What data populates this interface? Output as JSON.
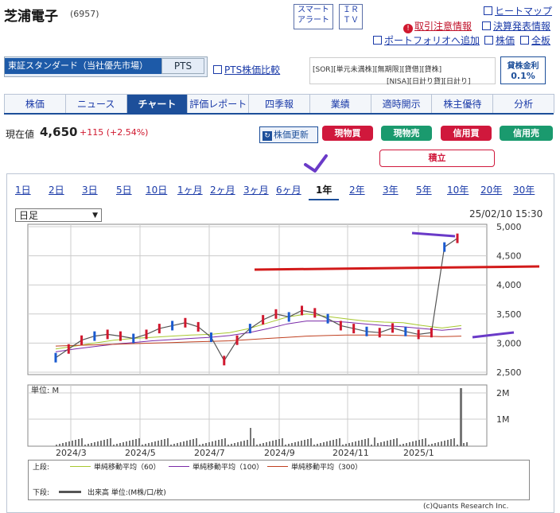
{
  "header": {
    "company_name": "芝浦電子",
    "code": "(6957)",
    "smart_alert_line1": "スマート",
    "smart_alert_line2": "アラート",
    "ir_line1": "ＩＲ",
    "ir_line2": "ＴＶ",
    "links": {
      "heatmap": "ヒートマップ",
      "attention": "取引注意情報",
      "earnings": "決算発表情報",
      "portfolio": "ポートフォリオへ追加",
      "stock_price": "株価",
      "all_boards": "全板"
    }
  },
  "market": {
    "name": "東証スタンダード（当社優先市場）",
    "pts_tab": "PTS",
    "pts_compare": "PTS株価比較",
    "badges_row1": [
      "[SOR]",
      "[単元未満株]",
      "[無期限]",
      "[貸借]",
      "[貸株]"
    ],
    "badges_row2": [
      "[NISA]",
      "[日計り貸]",
      "[日計り]"
    ],
    "lending_label": "貸株金利",
    "lending_rate": "0.1%"
  },
  "nav_tabs": [
    "株価",
    "ニュース",
    "チャート",
    "評価レポート",
    "四季報",
    "業績",
    "適時開示",
    "株主優待",
    "分析"
  ],
  "active_tab": "チャート",
  "price": {
    "label": "現在値",
    "value": "4,650",
    "change": "+115 (+2.54%)",
    "refresh_label": "株価更新"
  },
  "trade_buttons": {
    "cash_buy": "現物買",
    "cash_sell": "現物売",
    "margin_buy": "信用買",
    "margin_sell": "信用売",
    "accumulate": "積立"
  },
  "period_tabs": [
    "1日",
    "2日",
    "3日",
    "5日",
    "10日",
    "1ヶ月",
    "2ヶ月",
    "3ヶ月",
    "6ヶ月",
    "1年",
    "2年",
    "3年",
    "5年",
    "10年",
    "20年",
    "30年"
  ],
  "active_period": "1年",
  "chart_controls": {
    "interval_select": "日足",
    "timestamp": "25/02/10 15:30"
  },
  "chart_data": {
    "type": "line",
    "price_axis": {
      "ylim": [
        2500,
        5000
      ],
      "ticks": [
        "2,500",
        "3,000",
        "3,500",
        "4,000",
        "4,500",
        "5,000"
      ]
    },
    "volume_axis": {
      "label": "単位: M",
      "ticks": [
        "1M",
        "2M"
      ]
    },
    "x_ticks": [
      "2024/3",
      "2024/5",
      "2024/7",
      "2024/9",
      "2024/11",
      "2025/1"
    ],
    "series": [
      {
        "name": "単純移動平均（60）",
        "color": "#a8c830",
        "values": [
          2900,
          2950,
          3000,
          3050,
          3080,
          3100,
          3120,
          3140,
          3150,
          3180,
          3250,
          3350,
          3450,
          3500,
          3460,
          3420,
          3380,
          3360,
          3350,
          3300,
          3260,
          3300
        ]
      },
      {
        "name": "単純移動平均（100）",
        "color": "#7a2aa8",
        "values": [
          2850,
          2900,
          2940,
          2980,
          3010,
          3040,
          3060,
          3080,
          3100,
          3130,
          3180,
          3250,
          3330,
          3380,
          3380,
          3360,
          3330,
          3300,
          3280,
          3250,
          3220,
          3250
        ]
      },
      {
        "name": "単純移動平均（300）",
        "color": "#c04020",
        "values": [
          2950,
          2960,
          2970,
          2980,
          2990,
          3000,
          3010,
          3020,
          3030,
          3040,
          3060,
          3080,
          3100,
          3120,
          3130,
          3140,
          3140,
          3140,
          3130,
          3120,
          3110,
          3120
        ]
      }
    ],
    "price_path": [
      2750,
      2900,
      3050,
      3120,
      3150,
      3120,
      3080,
      3150,
      3250,
      3300,
      3350,
      3280,
      3100,
      2700,
      3050,
      3250,
      3400,
      3500,
      3450,
      3560,
      3520,
      3420,
      3300,
      3250,
      3200,
      3180,
      3260,
      3200,
      3150,
      3180,
      4650,
      4800
    ],
    "bottom_legend_label": "出来高 単位:(M株/口/枚)",
    "upper_label": "上段:",
    "lower_label": "下段:",
    "credit": "(c)Quants Research Inc."
  }
}
